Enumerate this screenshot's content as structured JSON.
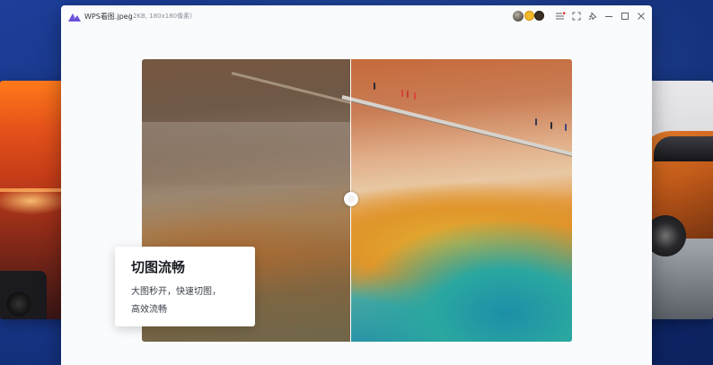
{
  "window": {
    "title": "WPS看图.jpeg",
    "meta": "( 2KB, 180x180像素)"
  },
  "titlebar_icons": [
    {
      "name": "menu-icon"
    },
    {
      "name": "fullscreen-icon"
    },
    {
      "name": "pin-icon"
    },
    {
      "name": "minimize-icon"
    },
    {
      "name": "maximize-icon"
    },
    {
      "name": "close-icon"
    }
  ],
  "feature": {
    "title": "切图流畅",
    "desc_line1": "大图秒开，快速切图，",
    "desc_line2": "高效流畅"
  },
  "colors": {
    "desktop": "#163482",
    "window_bg": "#fafbfd",
    "menu_dot": "#e23b3b",
    "badge_gold": "#f3b92b"
  }
}
